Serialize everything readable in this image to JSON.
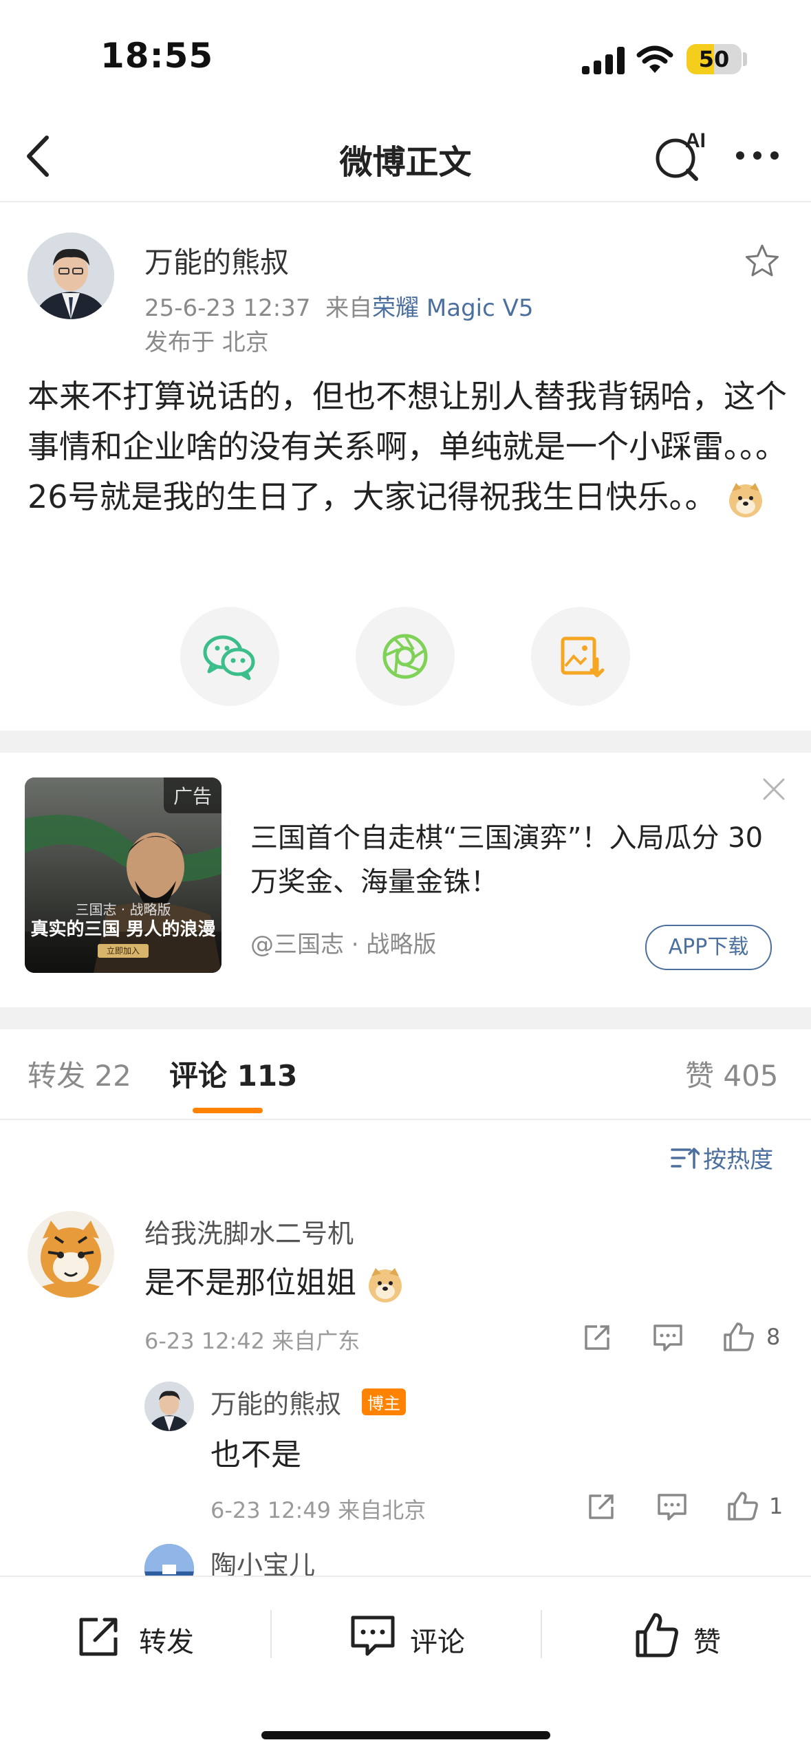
{
  "status_bar": {
    "time": "18:55",
    "battery": "50",
    "battery_level": 0.5
  },
  "nav": {
    "title": "微博正文"
  },
  "post": {
    "username": "万能的熊叔",
    "timestamp": "25-6-23 12:37",
    "from_prefix": "来自",
    "device": "荣耀 Magic V5",
    "location": "发布于 北京",
    "text": "本来不打算说话的，但也不想让别人替我背锅哈，这个事情和企业啥的没有关系啊，单纯就是一个小踩雷。。。26号就是我的生日了，大家记得祝我生日快乐。。"
  },
  "share_buttons": [
    "wechat-icon",
    "moments-icon",
    "save-image-icon"
  ],
  "ad": {
    "tag": "广告",
    "headline": "三国首个自走棋“三国演弈”！入局瓜分 30 万奖金、海量金铢！",
    "source": "@三国志 · 战略版",
    "button": "APP下载",
    "thumb_title": "真实的三国 男人的浪漫",
    "thumb_subtitle": "三国志 · 战略版",
    "thumb_button": "立即加入"
  },
  "tabs": {
    "repost": "转发 22",
    "comments": "评论 113",
    "likes": "赞 405"
  },
  "sort_label": "按热度",
  "comments": [
    {
      "name": "给我洗脚水二号机",
      "text": "是不是那位姐姐",
      "meta": "6-23 12:42  来自广东",
      "likes": "8",
      "replies": [
        {
          "name": "万能的熊叔",
          "badge": "博主",
          "text": "也不是",
          "meta": "6-23 12:49  来自北京",
          "likes": "1"
        },
        {
          "name": "陶小宝儿"
        }
      ]
    }
  ],
  "bottom_bar": {
    "repost": "转发",
    "comment": "评论",
    "like": "赞"
  },
  "colors": {
    "accent": "#ff8200",
    "link": "#4b6f9e",
    "wechat": "#3cbe8a",
    "moments": "#7fd158",
    "save": "#f5a623"
  }
}
